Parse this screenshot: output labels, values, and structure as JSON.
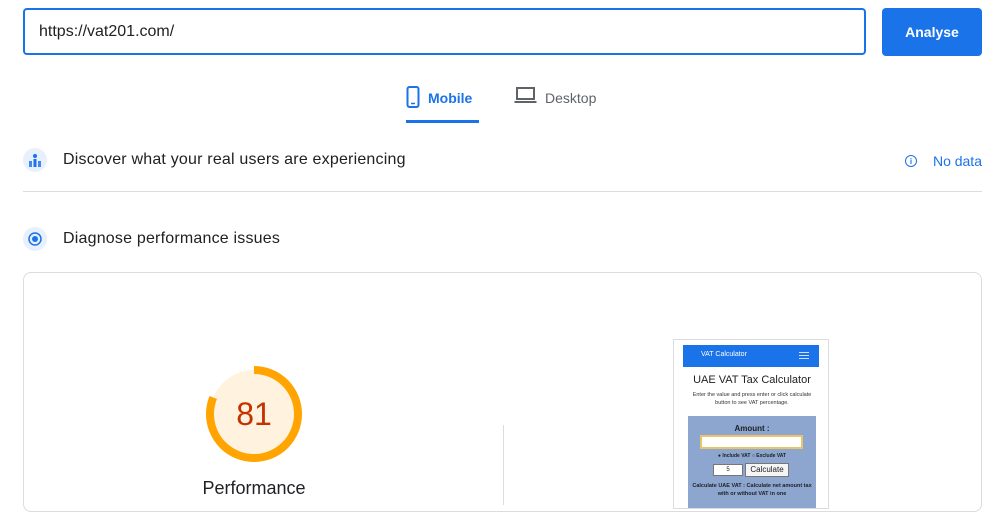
{
  "search": {
    "url_value": "https://vat201.com/",
    "analyse_label": "Analyse"
  },
  "tabs": [
    {
      "label": "Mobile",
      "icon": "phone-icon",
      "active": true
    },
    {
      "label": "Desktop",
      "icon": "laptop-icon",
      "active": false
    }
  ],
  "field_data": {
    "title": "Discover what your real users are experiencing",
    "status_label": "No data"
  },
  "lab_data": {
    "title": "Diagnose performance issues"
  },
  "score": {
    "value": "81",
    "label": "Performance",
    "fraction": 0.81
  },
  "screenshot": {
    "nav_title": "VAT Calculator",
    "heading": "UAE VAT Tax Calculator",
    "instructions": "Enter the value and press enter or click calculate button to see VAT percentage.",
    "amount_label": "Amount :",
    "radio_text": "● Include VAT ○ Exclude VAT",
    "rate_value": "5",
    "calculate_label": "Calculate",
    "description": "Calculate UAE VAT : Calculate net amount tax with or without VAT in one"
  },
  "colors": {
    "accent": "#1a73e8",
    "score_orange": "#ffa400",
    "score_text": "#c33300",
    "score_bg": "#fff3e0"
  }
}
